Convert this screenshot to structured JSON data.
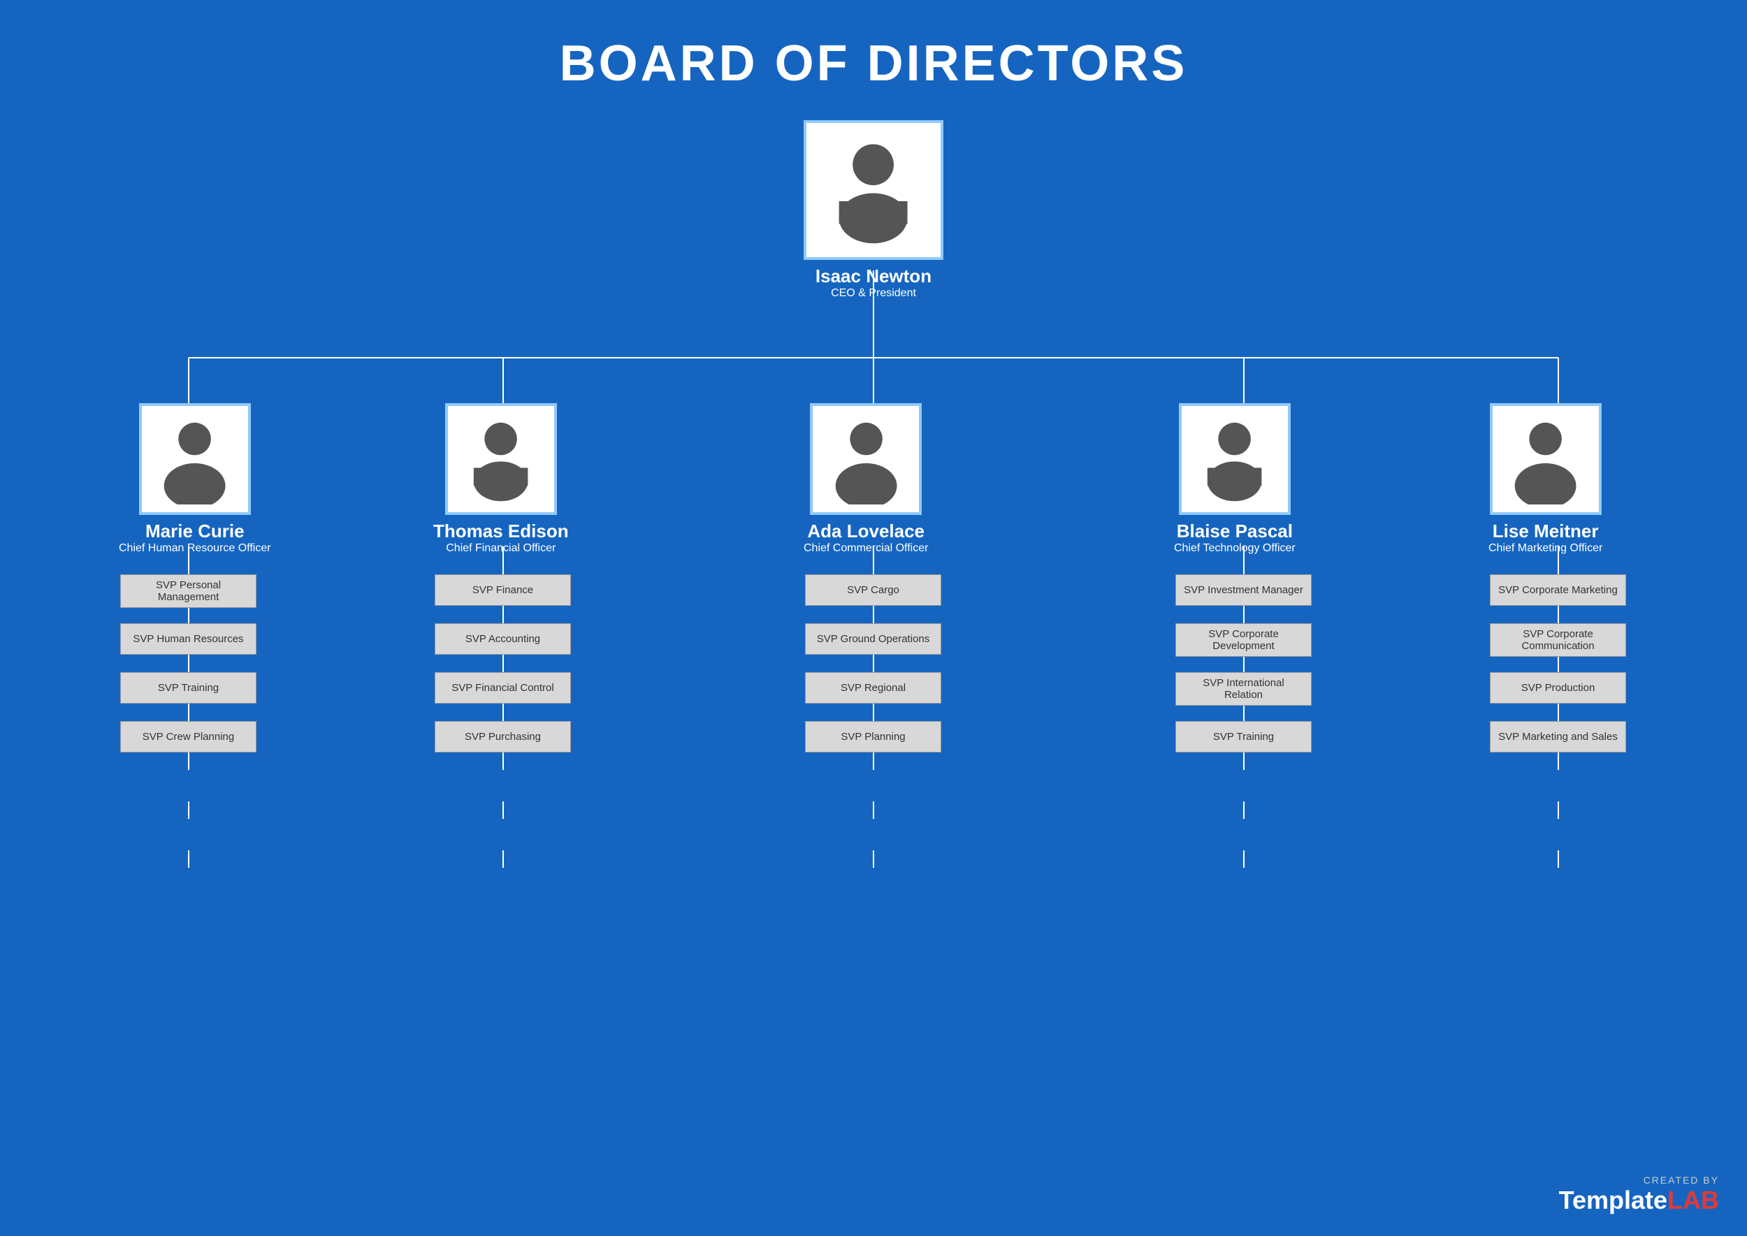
{
  "title": "BOARD OF DIRECTORS",
  "ceo": {
    "name": "Isaac Newton",
    "title": "CEO & President"
  },
  "directors": [
    {
      "name": "Marie Curie",
      "title": "Chief Human Resource Officer",
      "svps": [
        "SVP Personal Management",
        "SVP Human Resources",
        "SVP Training",
        "SVP Crew Planning"
      ]
    },
    {
      "name": "Thomas Edison",
      "title": "Chief Financial Officer",
      "svps": [
        "SVP Finance",
        "SVP Accounting",
        "SVP Financial Control",
        "SVP Purchasing"
      ]
    },
    {
      "name": "Ada Lovelace",
      "title": "Chief Commercial Officer",
      "svps": [
        "SVP Cargo",
        "SVP Ground Operations",
        "SVP Regional",
        "SVP Planning"
      ]
    },
    {
      "name": "Blaise Pascal",
      "title": "Chief Technology Officer",
      "svps": [
        "SVP Investment Manager",
        "SVP Corporate Development",
        "SVP International Relation",
        "SVP Training"
      ]
    },
    {
      "name": "Lise Meitner",
      "title": "Chief Marketing Officer",
      "svps": [
        "SVP Corporate Marketing",
        "SVP Corporate Communication",
        "SVP Production",
        "SVP Marketing and Sales"
      ]
    }
  ],
  "watermark": {
    "created_by": "CREATED BY",
    "brand_template": "Template",
    "brand_lab": "LAB"
  }
}
